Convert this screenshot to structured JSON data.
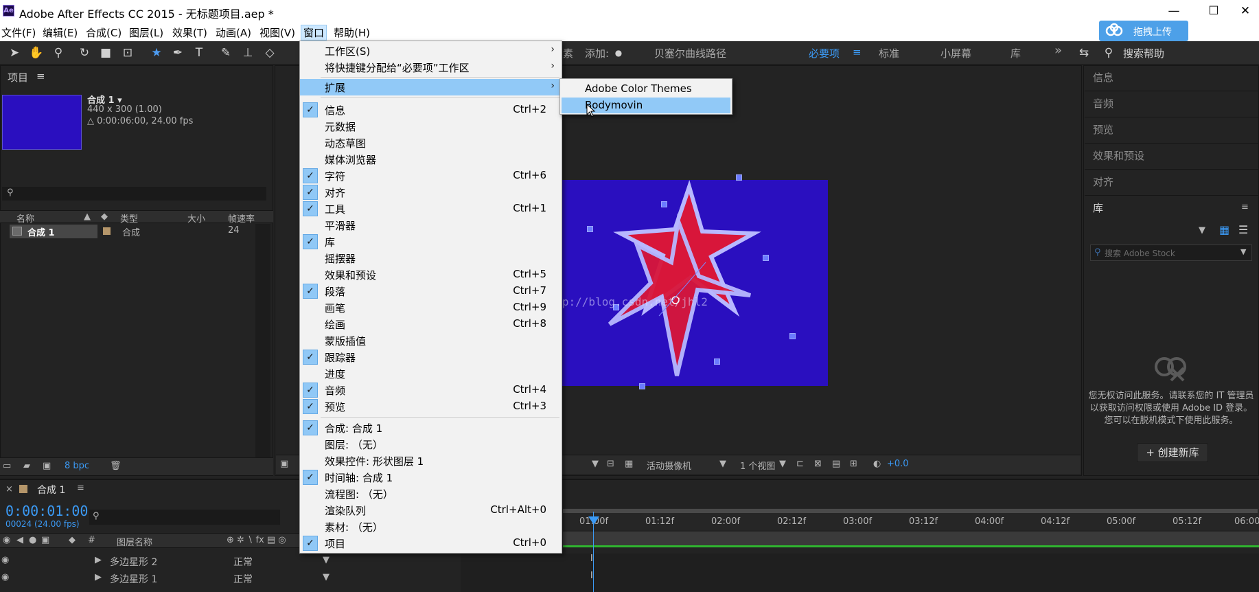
{
  "window": {
    "title": "Adobe After Effects CC 2015 - 无标题项目.aep *",
    "logo": "Ae",
    "minimize": "—",
    "maximize": "☐",
    "close": "✕"
  },
  "menubar": {
    "items": [
      "文件(F)",
      "编辑(E)",
      "合成(C)",
      "图层(L)",
      "效果(T)",
      "动画(A)",
      "视图(V)",
      "窗口",
      "帮助(H)"
    ],
    "upload_button": "拖拽上传"
  },
  "toolbar": {
    "add_label": "添加:",
    "bezier_label": "贝塞尔曲线路径",
    "partial_label": "素",
    "workspaces": [
      "必要项",
      "标准",
      "小屏幕",
      "库"
    ],
    "more": "»",
    "search_help": "搜索帮助"
  },
  "project_panel": {
    "title": "项目",
    "comp_name": "合成 1 ▾",
    "comp_size": "440 x 300 (1.00)",
    "comp_duration": "△ 0:00:06:00, 24.00 fps",
    "columns": [
      "名称",
      "类型",
      "大小",
      "帧速率"
    ],
    "row": {
      "name": "合成 1",
      "type": "合成",
      "fps": "24"
    },
    "bpc": "8 bpc"
  },
  "viewer": {
    "camera": "活动摄像机",
    "views": "1 个视图",
    "exposure": "+0.0"
  },
  "right_panels": {
    "items": [
      "信息",
      "音频",
      "预览",
      "效果和预设",
      "对齐"
    ],
    "library": "库",
    "stock_search_placeholder": "搜索 Adobe Stock",
    "offline_message": "您无权访问此服务。请联系您的 IT 管理员以获取访问权限或使用 Adobe ID 登录。您可以在脱机模式下使用此服务。",
    "create_library": "+ 创建新库"
  },
  "timeline": {
    "tab": "合成 1",
    "timecode": "0:00:01:00",
    "frames": "00024 (24.00 fps)",
    "layer_header": "图层名称",
    "hash": "#",
    "layers": [
      {
        "name": "多边星形 2",
        "mode": "正常"
      },
      {
        "name": "多边星形 1",
        "mode": "正常"
      }
    ],
    "ticks": [
      "01:00f",
      "01:12f",
      "02:00f",
      "02:12f",
      "03:00f",
      "03:12f",
      "04:00f",
      "04:12f",
      "05:00f",
      "05:12f",
      "06:00"
    ]
  },
  "window_menu": {
    "items": [
      {
        "label": "工作区(S)",
        "submenu": true
      },
      {
        "label": "将快捷键分配给“必要项”工作区",
        "submenu": true
      },
      {
        "label": "扩展",
        "submenu": true,
        "highlight": true
      },
      {
        "label": "信息",
        "checked": true,
        "shortcut": "Ctrl+2"
      },
      {
        "label": "元数据"
      },
      {
        "label": "动态草图"
      },
      {
        "label": "媒体浏览器"
      },
      {
        "label": "字符",
        "checked": true,
        "shortcut": "Ctrl+6"
      },
      {
        "label": "对齐",
        "checked": true
      },
      {
        "label": "工具",
        "checked": true,
        "shortcut": "Ctrl+1"
      },
      {
        "label": "平滑器"
      },
      {
        "label": "库",
        "checked": true
      },
      {
        "label": "摇摆器"
      },
      {
        "label": "效果和预设",
        "shortcut": "Ctrl+5"
      },
      {
        "label": "段落",
        "checked": true,
        "shortcut": "Ctrl+7"
      },
      {
        "label": "画笔",
        "shortcut": "Ctrl+9"
      },
      {
        "label": "绘画",
        "shortcut": "Ctrl+8"
      },
      {
        "label": "蒙版插值"
      },
      {
        "label": "跟踪器",
        "checked": true
      },
      {
        "label": "进度"
      },
      {
        "label": "音频",
        "checked": true,
        "shortcut": "Ctrl+4"
      },
      {
        "label": "预览",
        "checked": true,
        "shortcut": "Ctrl+3"
      },
      {
        "label": "合成: 合成 1",
        "checked": true
      },
      {
        "label": "图层: （无）"
      },
      {
        "label": "效果控件: 形状图层 1"
      },
      {
        "label": "时间轴: 合成 1",
        "checked": true
      },
      {
        "label": "流程图: （无）"
      },
      {
        "label": "渲染队列",
        "shortcut": "Ctrl+Alt+0"
      },
      {
        "label": "素材: （无）"
      },
      {
        "label": "项目",
        "checked": true,
        "shortcut": "Ctrl+0"
      }
    ]
  },
  "extension_submenu": {
    "items": [
      "Adobe Color Themes",
      "Bodymovin"
    ]
  },
  "watermark": "http://blog.csdn.net/jhl2"
}
